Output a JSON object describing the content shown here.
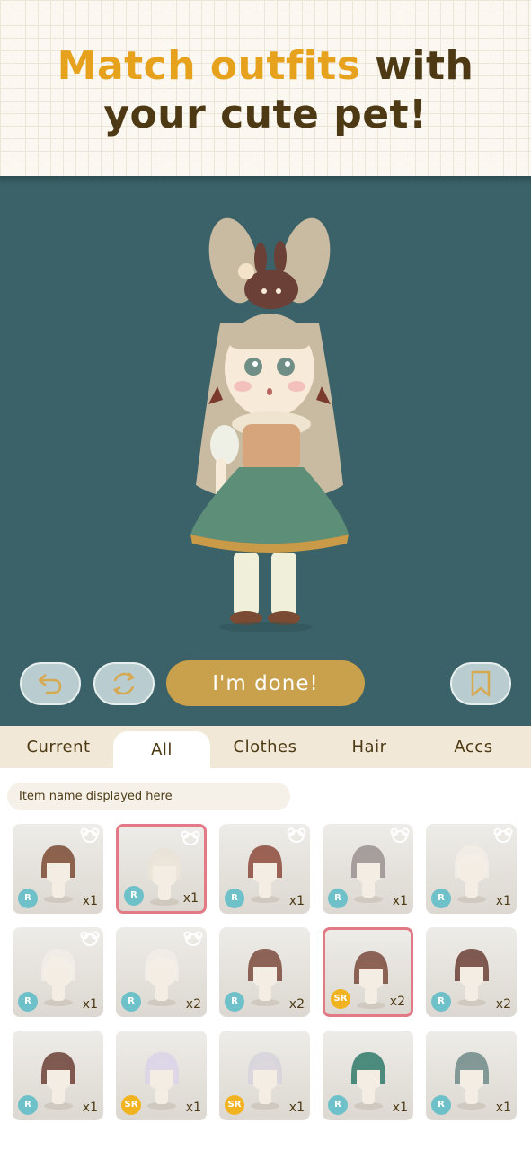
{
  "header": {
    "accent_words": "Match outfits",
    "line1_rest": " with",
    "line2": "your cute pet!"
  },
  "controls": {
    "undo_icon": "undo-arrow-icon",
    "random_icon": "shuffle-icon",
    "done_label": "I'm done!",
    "bookmark_icon": "bookmark-icon"
  },
  "tabs": [
    {
      "label": "Current",
      "active": false
    },
    {
      "label": "All",
      "active": true
    },
    {
      "label": "Clothes",
      "active": false
    },
    {
      "label": "Hair",
      "active": false
    },
    {
      "label": "Accs",
      "active": false
    }
  ],
  "item_name": "Item name displayed here",
  "items": [
    {
      "rarity": "R",
      "count": "x1",
      "pet": true,
      "selected": false,
      "art": "fluffy-hat-brown-hair"
    },
    {
      "rarity": "R",
      "count": "x1",
      "pet": true,
      "selected": true,
      "art": "bunny-ear-headband"
    },
    {
      "rarity": "R",
      "count": "x1",
      "pet": true,
      "selected": false,
      "art": "auburn-bob-hair"
    },
    {
      "rarity": "R",
      "count": "x1",
      "pet": true,
      "selected": false,
      "art": "grey-bob-hair"
    },
    {
      "rarity": "R",
      "count": "x1",
      "pet": true,
      "selected": false,
      "art": "antler-headband"
    },
    {
      "rarity": "R",
      "count": "x1",
      "pet": true,
      "selected": false,
      "art": "white-top-hat"
    },
    {
      "rarity": "R",
      "count": "x2",
      "pet": true,
      "selected": false,
      "art": "green-eyes-face"
    },
    {
      "rarity": "R",
      "count": "x2",
      "pet": false,
      "selected": false,
      "art": "bunny-ears"
    },
    {
      "rarity": "SR",
      "count": "x2",
      "pet": false,
      "selected": true,
      "art": "bunny-pet-hat"
    },
    {
      "rarity": "R",
      "count": "x2",
      "pet": false,
      "selected": false,
      "art": "bunny-doll-accessory"
    },
    {
      "rarity": "R",
      "count": "x1",
      "pet": false,
      "selected": false,
      "art": "bunny-balloon"
    },
    {
      "rarity": "SR",
      "count": "x1",
      "pet": false,
      "selected": false,
      "art": "lavender-hair"
    },
    {
      "rarity": "SR",
      "count": "x1",
      "pet": false,
      "selected": false,
      "art": "silver-twin-curls"
    },
    {
      "rarity": "R",
      "count": "x1",
      "pet": false,
      "selected": false,
      "art": "rainbow-messy-hair"
    },
    {
      "rarity": "R",
      "count": "x1",
      "pet": false,
      "selected": false,
      "art": "grey-green-messy-hair"
    }
  ],
  "colors": {
    "accent": "#e6a21d",
    "title_dark": "#4d3a14",
    "stage_bg": "#3b6268",
    "done_button": "#c9a04b",
    "rarity_r": "#6fc1c9",
    "rarity_sr": "#f2b320",
    "selected_border": "#e27a86"
  }
}
